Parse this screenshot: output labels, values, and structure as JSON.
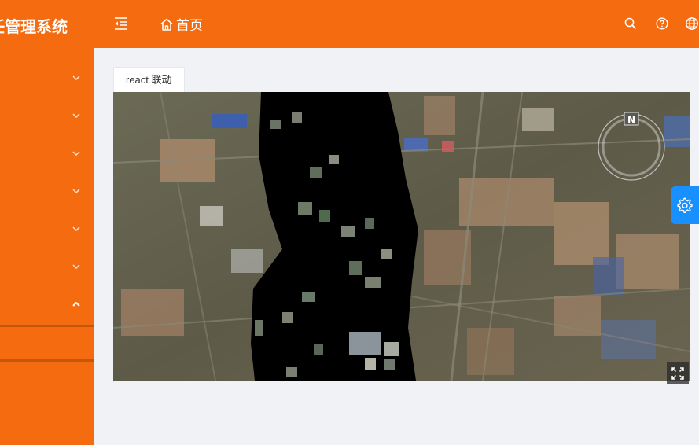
{
  "app": {
    "title": "任管理系统"
  },
  "header": {
    "breadcrumb_home": "首页",
    "icons": [
      "menu-fold-icon",
      "home-icon",
      "search-icon",
      "question-icon",
      "globe-icon"
    ]
  },
  "sidebar": {
    "items": [
      {
        "expanded": false
      },
      {
        "expanded": false
      },
      {
        "expanded": false
      },
      {
        "expanded": false
      },
      {
        "expanded": false
      },
      {
        "expanded": false
      },
      {
        "expanded": true
      }
    ]
  },
  "tabs": [
    {
      "label": "react 联动"
    }
  ],
  "colors": {
    "primary": "#f56b10",
    "accent": "#1890ff",
    "background": "#f0f2f5"
  }
}
